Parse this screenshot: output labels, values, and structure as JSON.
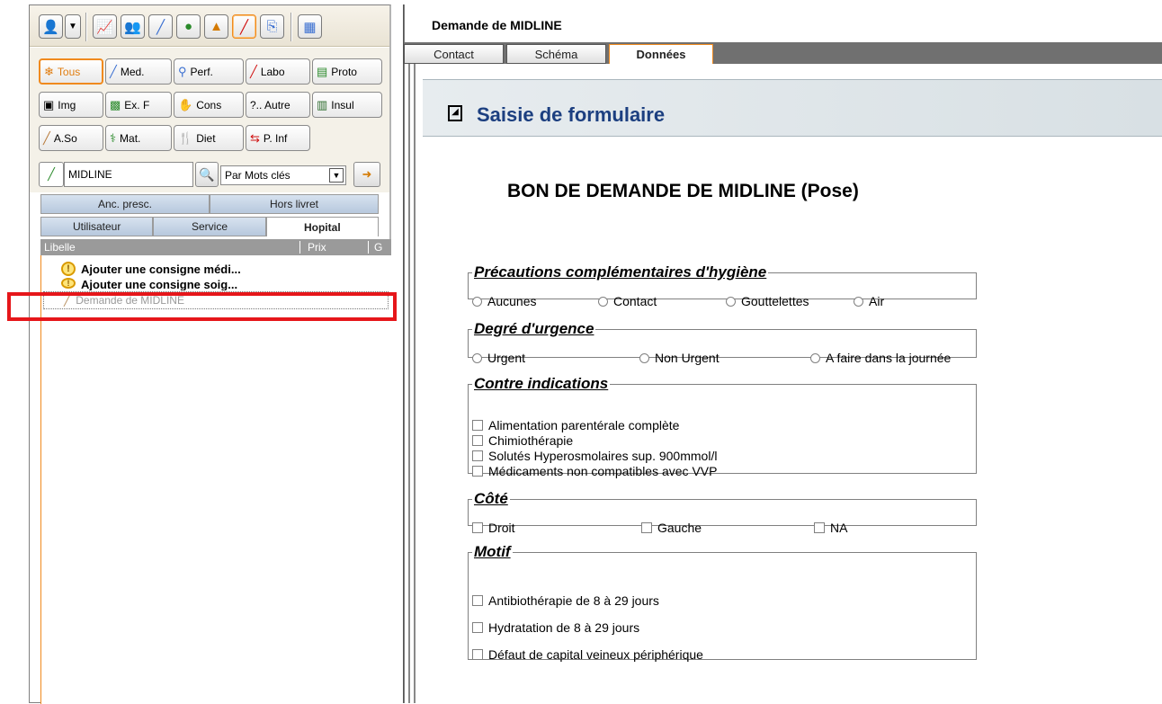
{
  "toolbar": {
    "icons": [
      "patient-icon",
      "dropdown-arrow",
      "chart-icon",
      "team-icon",
      "syringe-icon",
      "globe-icon",
      "warning-icon",
      "red-pen-icon",
      "export-icon",
      "grid-icon"
    ]
  },
  "categories": {
    "tous": "Tous",
    "med": "Med.",
    "perf": "Perf.",
    "labo": "Labo",
    "proto": "Proto",
    "img": "Img",
    "exf": "Ex. F",
    "cons": "Cons",
    "autre": "?.. Autre",
    "insul": "Insul",
    "aso": "A.So",
    "mat": "Mat.",
    "diet": "Diet",
    "pinf": "P. Inf"
  },
  "search": {
    "value": "MIDLINE",
    "mode": "Par Mots clés"
  },
  "tabs_top": [
    "Anc. presc.",
    "Hors livret"
  ],
  "tabs_bottom": [
    "Utilisateur",
    "Service",
    "Hopital"
  ],
  "list": {
    "columns": [
      "Libelle",
      "Prix",
      "G"
    ],
    "items": [
      "Ajouter une consigne médi...",
      "Ajouter une consigne soig...",
      "Demande de MIDLINE"
    ]
  },
  "right": {
    "title": "Demande de MIDLINE",
    "tabs": [
      "Contact",
      "Schéma",
      "Données"
    ],
    "banner": "Saisie de formulaire",
    "form_title": "BON DE DEMANDE DE MIDLINE (Pose)",
    "groups": {
      "hygiene": {
        "legend": "Précautions complémentaires d'hygiène",
        "options": [
          "Aucunes",
          "Contact",
          "Gouttelettes",
          "Air"
        ]
      },
      "urgence": {
        "legend": "Degré d'urgence",
        "options": [
          "Urgent",
          "Non Urgent",
          "A faire dans la journée"
        ]
      },
      "contre": {
        "legend": "Contre indications",
        "options": [
          "Alimentation parentérale complète",
          "Chimiothérapie",
          "Solutés Hyperosmolaires sup. 900mmol/l",
          "Médicaments non compatibles avec VVP"
        ]
      },
      "cote": {
        "legend": "Côté",
        "options": [
          "Droit",
          "Gauche",
          "NA"
        ]
      },
      "motif": {
        "legend": "Motif",
        "options": [
          "Antibiothérapie de 8 à 29 jours",
          "Hydratation de 8 à 29 jours",
          "Défaut de capital veineux périphérique"
        ]
      }
    }
  }
}
